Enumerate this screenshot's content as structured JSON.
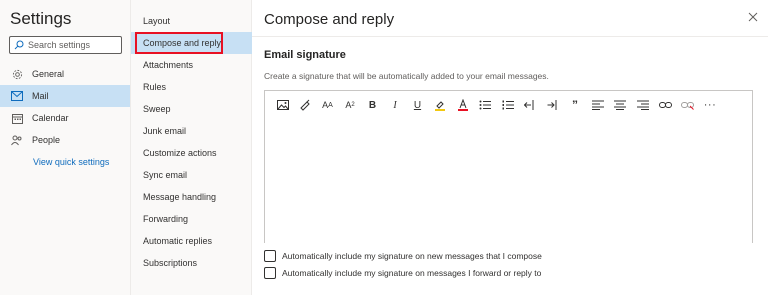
{
  "settings": {
    "title": "Settings",
    "search_placeholder": "Search settings"
  },
  "nav": {
    "items": [
      {
        "label": "General",
        "icon": "gear-icon"
      },
      {
        "label": "Mail",
        "icon": "mail-icon",
        "active": true
      },
      {
        "label": "Calendar",
        "icon": "calendar-icon"
      },
      {
        "label": "People",
        "icon": "people-icon"
      }
    ],
    "quick_settings_link": "View quick settings"
  },
  "submenu": {
    "items": [
      {
        "label": "Layout"
      },
      {
        "label": "Compose and reply",
        "active": true
      },
      {
        "label": "Attachments"
      },
      {
        "label": "Rules"
      },
      {
        "label": "Sweep"
      },
      {
        "label": "Junk email"
      },
      {
        "label": "Customize actions"
      },
      {
        "label": "Sync email"
      },
      {
        "label": "Message handling"
      },
      {
        "label": "Forwarding"
      },
      {
        "label": "Automatic replies"
      },
      {
        "label": "Subscriptions"
      }
    ]
  },
  "pane": {
    "title": "Compose and reply",
    "section_title": "Email signature",
    "section_desc": "Create a signature that will be automatically added to your email messages.",
    "toolbar_icons": [
      "insert-picture-icon",
      "format-painter-icon",
      "font-size-icon",
      "superscript-icon",
      "bold-icon",
      "italic-icon",
      "underline-icon",
      "highlight-icon",
      "font-color-icon",
      "bullets-icon",
      "numbering-icon",
      "decrease-indent-icon",
      "increase-indent-icon",
      "quote-icon",
      "align-left-icon",
      "align-center-icon",
      "align-right-icon",
      "insert-link-icon",
      "remove-link-icon",
      "more-options-icon"
    ],
    "checkbox_new": "Automatically include my signature on new messages that I compose",
    "checkbox_forward": "Automatically include my signature on messages I forward or reply to"
  },
  "colors": {
    "accent": "#0f6cbd",
    "selected_bg": "#c7e0f4",
    "highlight_frame": "#e81123"
  }
}
